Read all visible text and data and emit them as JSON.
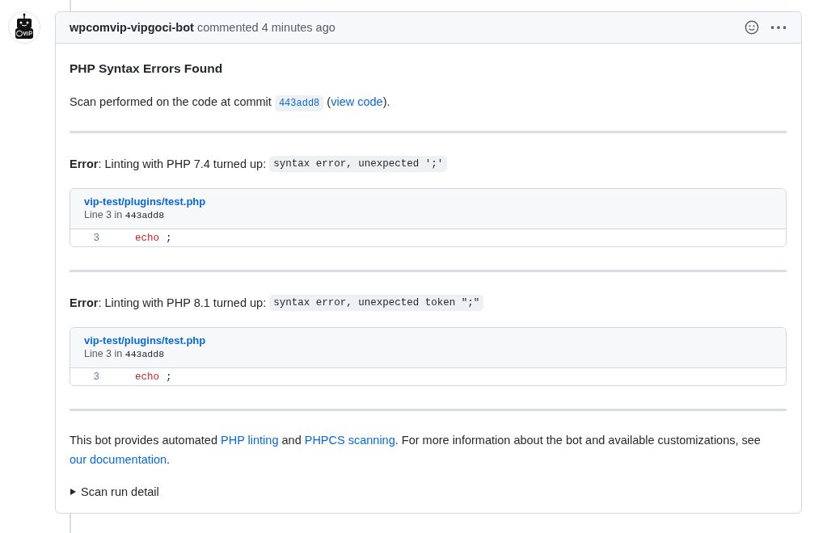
{
  "comment": {
    "author": "wpcomvip-vipgoci-bot",
    "action": "commented 4 minutes ago",
    "title": "PHP Syntax Errors Found",
    "intro": [
      {
        "kind": "text",
        "text": "Scan performed on the code at commit "
      },
      {
        "kind": "code_link",
        "text": "443add8"
      },
      {
        "kind": "text",
        "text": " ("
      },
      {
        "kind": "link",
        "text": "view code"
      },
      {
        "kind": "text",
        "text": ")."
      }
    ],
    "errors": [
      {
        "message": "**Error**: Linting with PHP 7.4 turned up:",
        "detail": "syntax error, unexpected ';'",
        "file": "vip-test/plugins/test.php",
        "location": "Line 3 in",
        "commit": "443add8",
        "line_number": "3",
        "keyword": "echo",
        "rest": ";"
      },
      {
        "message": "**Error**: Linting with PHP 8.1 turned up:",
        "detail": "syntax error, unexpected token \";\"",
        "file": "vip-test/plugins/test.php",
        "location": "Line 3 in",
        "commit": "443add8",
        "line_number": "3",
        "keyword": "echo",
        "rest": ";"
      }
    ],
    "footer": [
      {
        "kind": "text",
        "text": "This bot provides automated "
      },
      {
        "kind": "link",
        "text": "PHP linting"
      },
      {
        "kind": "text",
        "text": " and "
      },
      {
        "kind": "link",
        "text": "PHPCS scanning"
      },
      {
        "kind": "text",
        "text": ". For more information about the bot and available customizations, see "
      },
      {
        "kind": "link",
        "text": "our documentation"
      },
      {
        "kind": "text",
        "text": "."
      }
    ],
    "details": {
      "summary": "Scan run detail",
      "expanded": false
    }
  }
}
